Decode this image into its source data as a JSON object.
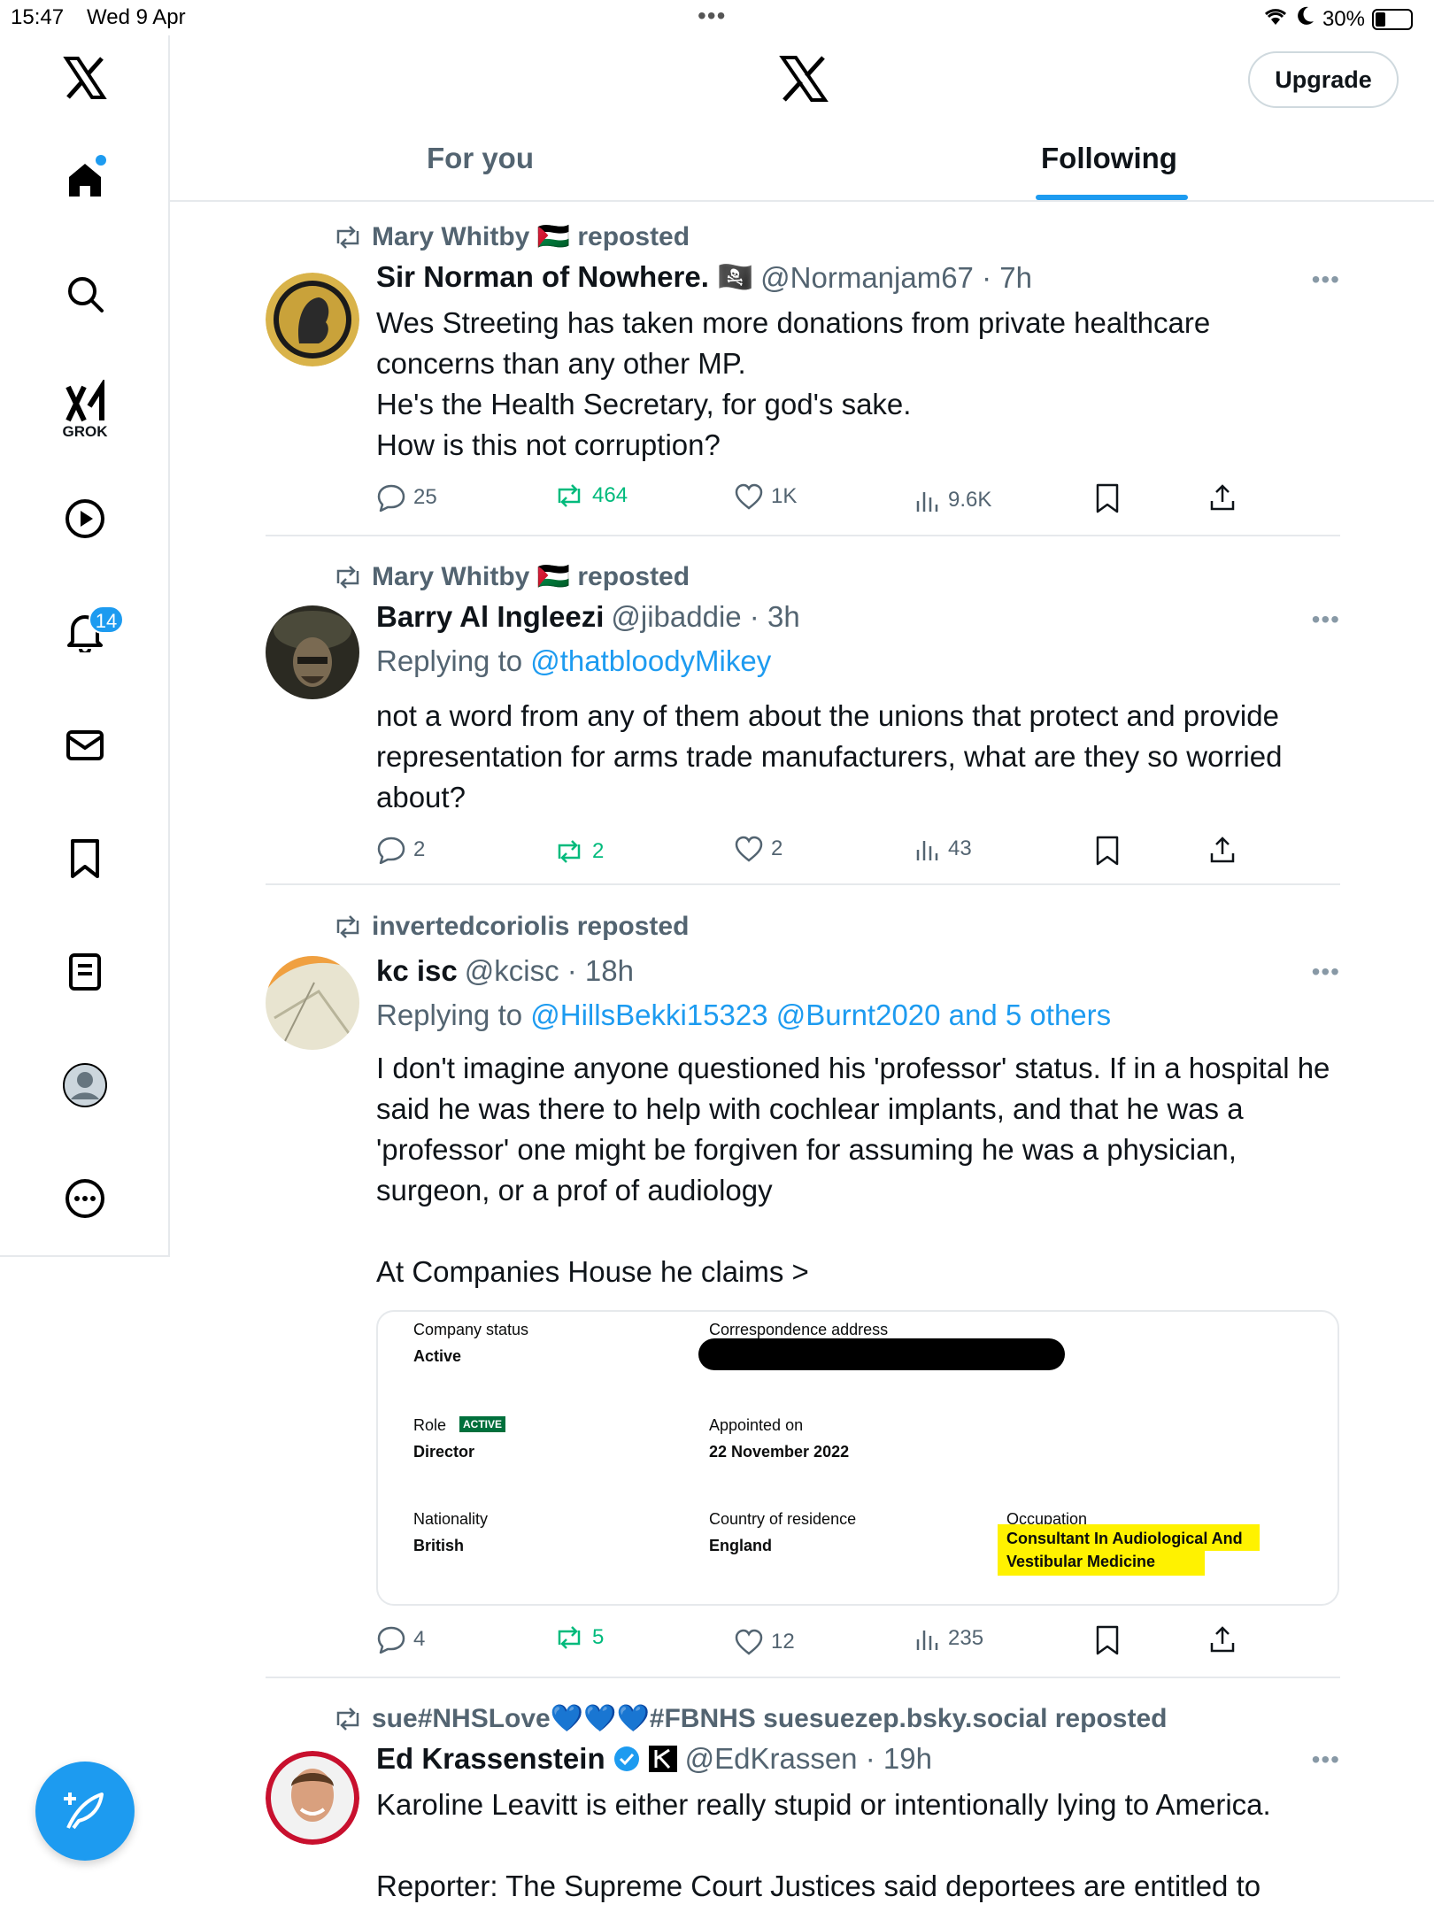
{
  "status_bar": {
    "time": "15:47",
    "date": "Wed 9 Apr",
    "battery": "30%",
    "battery_level": 0.3
  },
  "header": {
    "upgrade_label": "Upgrade",
    "tabs": [
      {
        "label": "For you"
      },
      {
        "label": "Following"
      }
    ]
  },
  "sidebar": {
    "grok_label": "GROK",
    "notifications_count": "14"
  },
  "tweets": [
    {
      "reposted_by": "Mary Whitby 🇵🇸 reposted",
      "name": "Sir Norman of Nowhere. 🏴‍☠️",
      "handle": "@Normanjam67 · 7h",
      "lines": [
        "Wes Streeting has taken more donations from private healthcare concerns than any other MP.",
        "He's the Health Secretary, for god's sake.",
        "How is this not corruption?"
      ],
      "stats": {
        "replies": "25",
        "reposts": "464",
        "likes": "1K",
        "views": "9.6K"
      }
    },
    {
      "reposted_by": "Mary Whitby 🇵🇸 reposted",
      "name": "Barry Al Ingleezi",
      "handle": "@jibaddie · 3h",
      "replying_prefix": "Replying to ",
      "replying_to": "@thatbloodyMikey",
      "lines": [
        "not a word from any of them about the unions that protect and provide representation for arms trade manufacturers, what are they so worried about?"
      ],
      "stats": {
        "replies": "2",
        "reposts": "2",
        "likes": "2",
        "views": "43"
      }
    },
    {
      "reposted_by": "invertedcoriolis reposted",
      "name": "kc isc",
      "handle": "@kcisc · 18h",
      "replying_prefix": "Replying to ",
      "replying_to": "@HillsBekki15323 @Burnt2020 and 5 others",
      "lines": [
        "I don't imagine anyone questioned his 'professor' status. If in a hospital he said he was there to help with cochlear implants,  and that he was a 'professor'  one might be forgiven for assuming he was a physician, surgeon, or a prof of audiology",
        "At Companies House he claims >"
      ],
      "card": {
        "company_status_label": "Company status",
        "company_status": "Active",
        "correspondence_label": "Correspondence address",
        "role_label": "Role",
        "role_tag": "ACTIVE",
        "role": "Director",
        "appointed_label": "Appointed on",
        "appointed": "22 November 2022",
        "nationality_label": "Nationality",
        "nationality": "British",
        "residence_label": "Country of residence",
        "residence": "England",
        "occupation_label": "Occupation",
        "occupation_line1": "Consultant In Audiological And",
        "occupation_line2": "Vestibular Medicine"
      },
      "stats": {
        "replies": "4",
        "reposts": "5",
        "likes": "12",
        "views": "235"
      }
    },
    {
      "reposted_by": "sue#NHSLove💙💙💙#FBNHS suesuezep.bsky.social reposted",
      "name": "Ed Krassenstein",
      "handle": "@EdKrassen · 19h",
      "lines": [
        "Karoline Leavitt is either really stupid or intentionally lying to America.",
        "Reporter: The Supreme Court Justices said deportees are entitled to"
      ]
    }
  ],
  "colors": {
    "accent": "#1d9bf0",
    "repost_green": "#00ba7c",
    "muted": "#536471"
  }
}
